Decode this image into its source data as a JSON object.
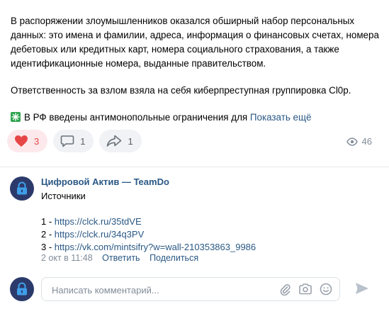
{
  "post": {
    "paragraph1": "В распоряжении злоумышленников оказался обширный набор персональных данных: это имена и фамилии, адреса, информация о финансовых счетах, номера дебетовых или кредитных карт, номера социального страхования, а также идентификационные номера, выданные правительством.",
    "paragraph2": "Ответственность за взлом взяла на себя киберпреступная группировка Cl0p.",
    "paragraph3": "В РФ введены антимонопольные ограничения для",
    "show_more": "Показать ещё"
  },
  "actions": {
    "likes": "3",
    "comments": "1",
    "shares": "1",
    "views": "46"
  },
  "comment": {
    "author": "Цифровой Актив — TeamDo",
    "text": "Источники",
    "links": [
      {
        "num": "1 - ",
        "url": "https://clck.ru/35tdVE"
      },
      {
        "num": "2 - ",
        "url": "https://clck.ru/34q3PV"
      },
      {
        "num": "3 - ",
        "url": "https://vk.com/mintsifry?w=wall-210353863_9986"
      }
    ],
    "date": "2 окт в 11:48",
    "reply": "Ответить",
    "share": "Поделиться"
  },
  "composer": {
    "placeholder": "Написать комментарий..."
  },
  "colors": {
    "link": "#2a5885",
    "like": "#e64646",
    "muted": "#818c99"
  }
}
